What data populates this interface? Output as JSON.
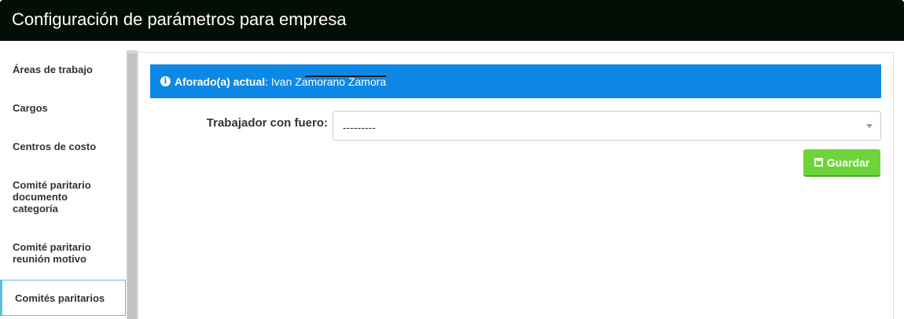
{
  "header": {
    "title": "Configuración de parámetros para empresa"
  },
  "sidebar": {
    "items": [
      {
        "label": "Áreas de trabajo"
      },
      {
        "label": "Cargos"
      },
      {
        "label": "Centros de costo"
      },
      {
        "label": "Comité paritario documento categoría"
      },
      {
        "label": "Comité paritario reunión motivo"
      },
      {
        "label": "Comités paritarios"
      }
    ],
    "active_index": 5
  },
  "alert": {
    "icon": "info-circle-icon",
    "label": "Aforado(a) actual",
    "separator": ":",
    "value": "Ivan Zamorano Zamora",
    "color": "#0e88e6"
  },
  "form": {
    "field_label": "Trabajador con fuero:",
    "select_value": "---------",
    "save_label": "Guardar",
    "save_icon": "floppy-disk-icon",
    "save_color": "#6dd43a"
  }
}
